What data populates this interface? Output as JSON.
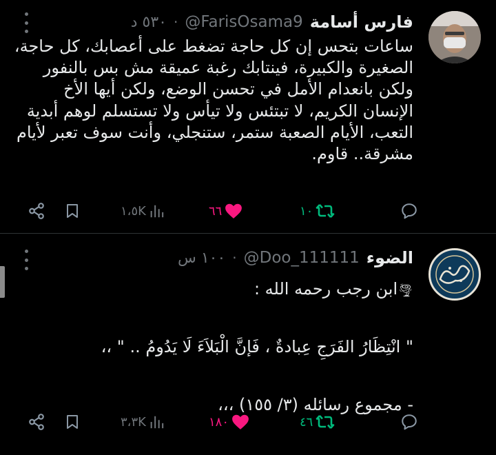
{
  "tweets": [
    {
      "display_name": "فارس أسامة",
      "handle": "@FarisOsama9",
      "time": "٥٣٠ د",
      "text": "ساعات بتحس إن كل حاجة تضغط على أعصابك، كل حاجة، الصغيرة والكبيرة، فينتابك رغبة عميقة مش بس بالنفور ولكن بانعدام الأمل في تحسن الوضع، ولكن أيها الأخ الإنسان الكريم، لا تبتئس ولا تيأس ولا تستسلم لوهم أبدية التعب، الأيام الصعبة ستمر، ستنجلي، وأنت سوف تعبر لأيام مشرقة.. قاوم.",
      "replies": "",
      "retweets": "١٠",
      "likes": "٦٦",
      "views": "١،٥K",
      "liked": true,
      "retweeted": true,
      "avatar_icon": "person-photo"
    },
    {
      "display_name": "الضوء",
      "handle": "@Doo_111111",
      "time": "١٠٠ س",
      "text_lines": [
        "ابن رجب رحمه الله :",
        "",
        "\"  انْتِظَارُ الفَرَجِ عِبادةٌ ، فَإنَّ الْبَلاَءَ لَا يَدُومُ .. \" ،،",
        "",
        "- مجموع رسائله (٣/ ١٥٥) ،،،"
      ],
      "text_prefix_icon": "🌪",
      "replies": "",
      "retweets": "٤٦",
      "likes": "١٨٠",
      "views": "٣،٣K",
      "liked": true,
      "retweeted": true,
      "avatar_icon": "alfurqan-logo"
    }
  ],
  "colors": {
    "background": "#000000",
    "text": "#e7e9ea",
    "muted": "#71767b",
    "like": "#f91880",
    "retweet": "#00ba7c",
    "divider": "#2f3336"
  }
}
